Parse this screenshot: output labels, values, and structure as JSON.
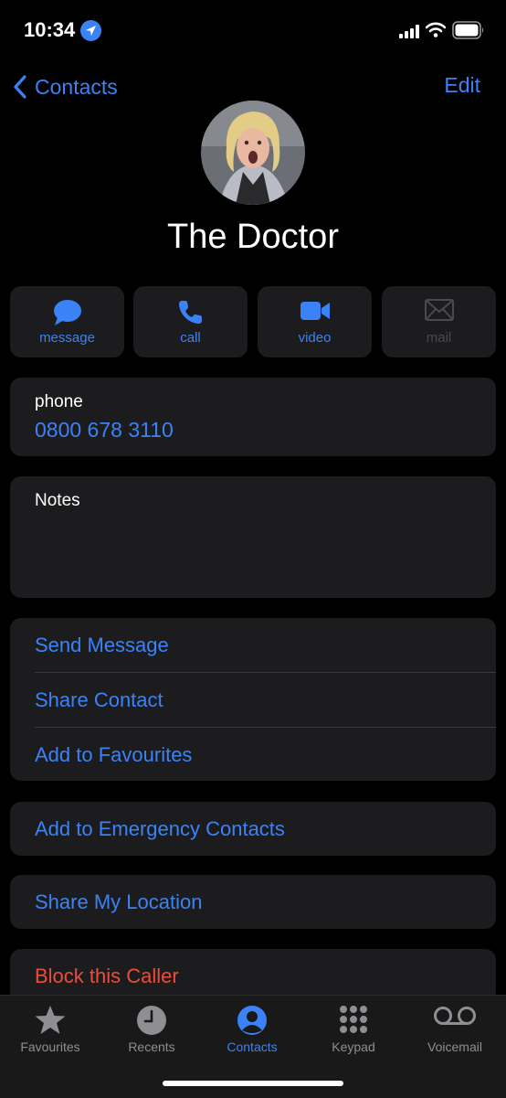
{
  "status": {
    "time": "10:34",
    "icons": [
      "location-arrow-icon",
      "cellular-signal-icon",
      "wifi-icon",
      "battery-icon"
    ]
  },
  "nav": {
    "back_label": "Contacts",
    "edit_label": "Edit"
  },
  "contact": {
    "name": "The Doctor"
  },
  "actions": [
    {
      "label": "message",
      "icon": "message-bubble-icon",
      "enabled": true
    },
    {
      "label": "call",
      "icon": "phone-icon",
      "enabled": true
    },
    {
      "label": "video",
      "icon": "video-camera-icon",
      "enabled": true
    },
    {
      "label": "mail",
      "icon": "envelope-icon",
      "enabled": false
    }
  ],
  "phone": {
    "label": "phone",
    "number": "0800 678 3110"
  },
  "notes": {
    "label": "Notes"
  },
  "options": {
    "send_message": "Send Message",
    "share_contact": "Share Contact",
    "add_favourites": "Add to Favourites",
    "emergency": "Add to Emergency Contacts",
    "share_location": "Share My Location",
    "block": "Block this Caller"
  },
  "tabs": [
    {
      "label": "Favourites",
      "icon": "star-icon",
      "active": false
    },
    {
      "label": "Recents",
      "icon": "clock-icon",
      "active": false
    },
    {
      "label": "Contacts",
      "icon": "person-circle-icon",
      "active": true
    },
    {
      "label": "Keypad",
      "icon": "keypad-icon",
      "active": false
    },
    {
      "label": "Voicemail",
      "icon": "voicemail-icon",
      "active": false
    }
  ],
  "colors": {
    "accent": "#3b82f6",
    "destructive": "#eb4d3d",
    "card_background": "#1c1c1e",
    "tab_inactive": "#8e8e93"
  }
}
